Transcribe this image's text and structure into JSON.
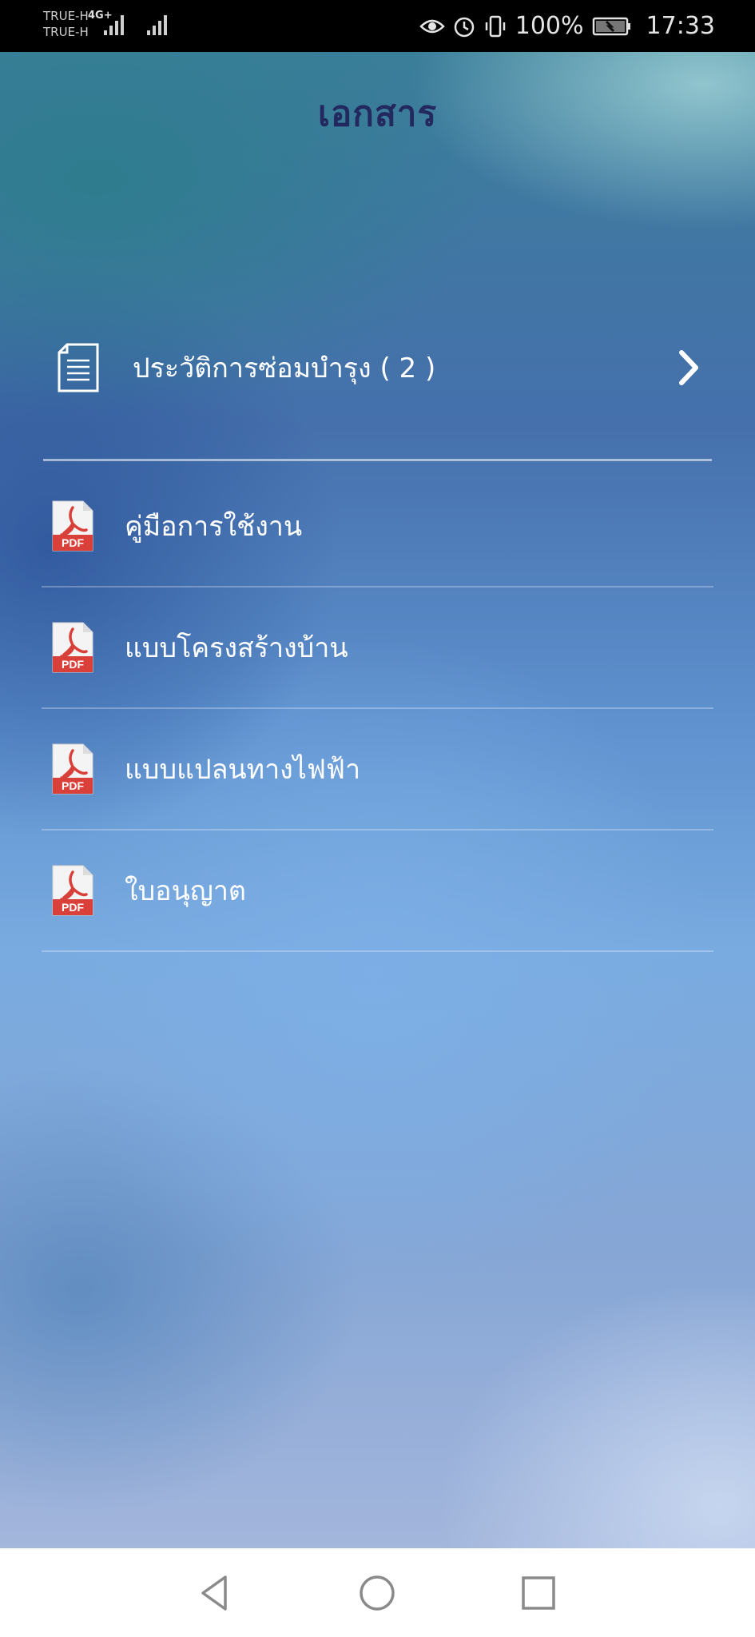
{
  "status_bar": {
    "carrier_1": "TRUE-H",
    "carrier_2": "TRUE-H",
    "network_type": "4G+",
    "battery_percent": "100%",
    "time": "17:33",
    "icons": [
      "eye-comfort-icon",
      "alarm-icon",
      "vibrate-icon",
      "battery-charging-icon"
    ]
  },
  "header": {
    "title": "เอกสาร"
  },
  "maintenance_section": {
    "label": "ประวัติการซ่อมบำรุง ( 2 )",
    "icon": "document-icon",
    "chevron": "chevron-right-icon"
  },
  "documents": [
    {
      "label": "คู่มือการใช้งาน",
      "icon": "pdf-icon"
    },
    {
      "label": "แบบโครงสร้างบ้าน",
      "icon": "pdf-icon"
    },
    {
      "label": "แบบแปลนทางไฟฟ้า",
      "icon": "pdf-icon"
    },
    {
      "label": "ใบอนุญาต",
      "icon": "pdf-icon"
    }
  ],
  "nav_bar": {
    "icons": [
      "back-icon",
      "home-icon",
      "recents-icon"
    ]
  },
  "colors": {
    "title": "#23285e",
    "pdf_red": "#d9403a",
    "text": "#ffffff"
  }
}
